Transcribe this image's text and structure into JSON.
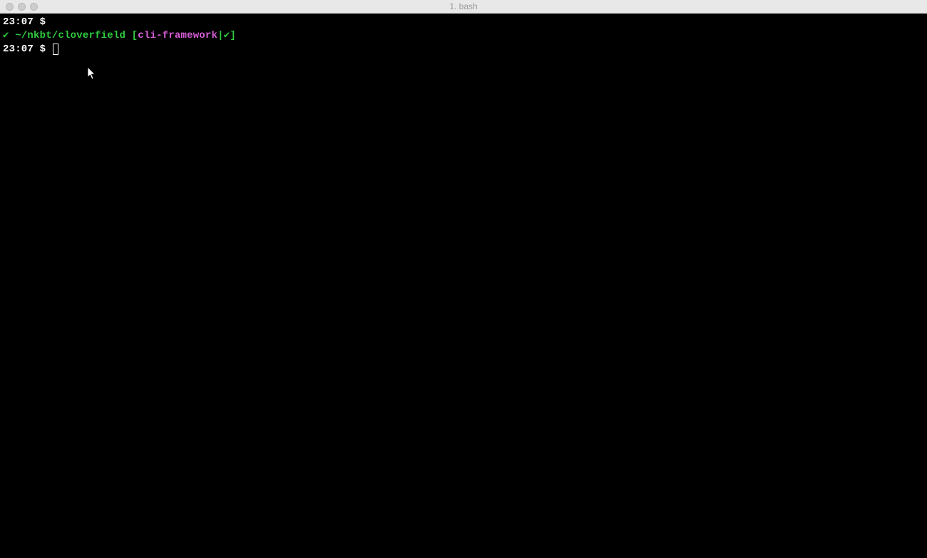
{
  "window": {
    "title": "1. bash"
  },
  "terminal": {
    "line1": {
      "time": "23:07",
      "dollar": " $ "
    },
    "line2": {
      "check": "✔ ",
      "path": "~/nkbt/cloverfield ",
      "bracket_open": "[",
      "branch": "cli-framework",
      "pipe": "|",
      "status_check": "✔",
      "bracket_close": "]"
    },
    "line3": {
      "time": "23:07",
      "dollar": " $ "
    }
  }
}
